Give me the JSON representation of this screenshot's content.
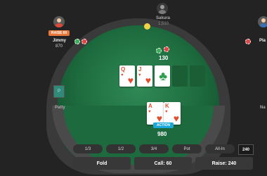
{
  "players": {
    "top": {
      "name": "Sakura",
      "stack": "1,510"
    },
    "left": {
      "name": "Jimmy",
      "stack": "870",
      "badge": "RAISE 60"
    },
    "right_top": {
      "name": "Pla"
    },
    "left_side": {
      "name": "Patty",
      "seat_label": "P"
    },
    "right_side": {
      "name": "Na"
    }
  },
  "pot": "130",
  "board": [
    {
      "rank": "Q",
      "suit": "♥"
    },
    {
      "rank": "J",
      "suit": "♥"
    },
    {
      "rank": "",
      "suit": "♣"
    },
    {
      "rank": "",
      "suit": ""
    },
    {
      "rank": "",
      "suit": ""
    }
  ],
  "hero": {
    "cards": [
      {
        "rank": "A",
        "suit": "♥"
      },
      {
        "rank": "K",
        "suit": "♥"
      }
    ],
    "badge": "ACTION",
    "stack": "980"
  },
  "bet_sizes": [
    "1/3",
    "1/2",
    "3/4",
    "Pot",
    "All-In"
  ],
  "bet_amount": "240",
  "actions": {
    "fold": "Fold",
    "call": "Call: 60",
    "raise": "Raise: 240"
  },
  "colors": {
    "felt": "#1d6a3e",
    "raise_badge": "#e8773a",
    "action_badge": "#1aa7d9",
    "card_red": "#e0502f",
    "card_green": "#2e9e4f"
  }
}
